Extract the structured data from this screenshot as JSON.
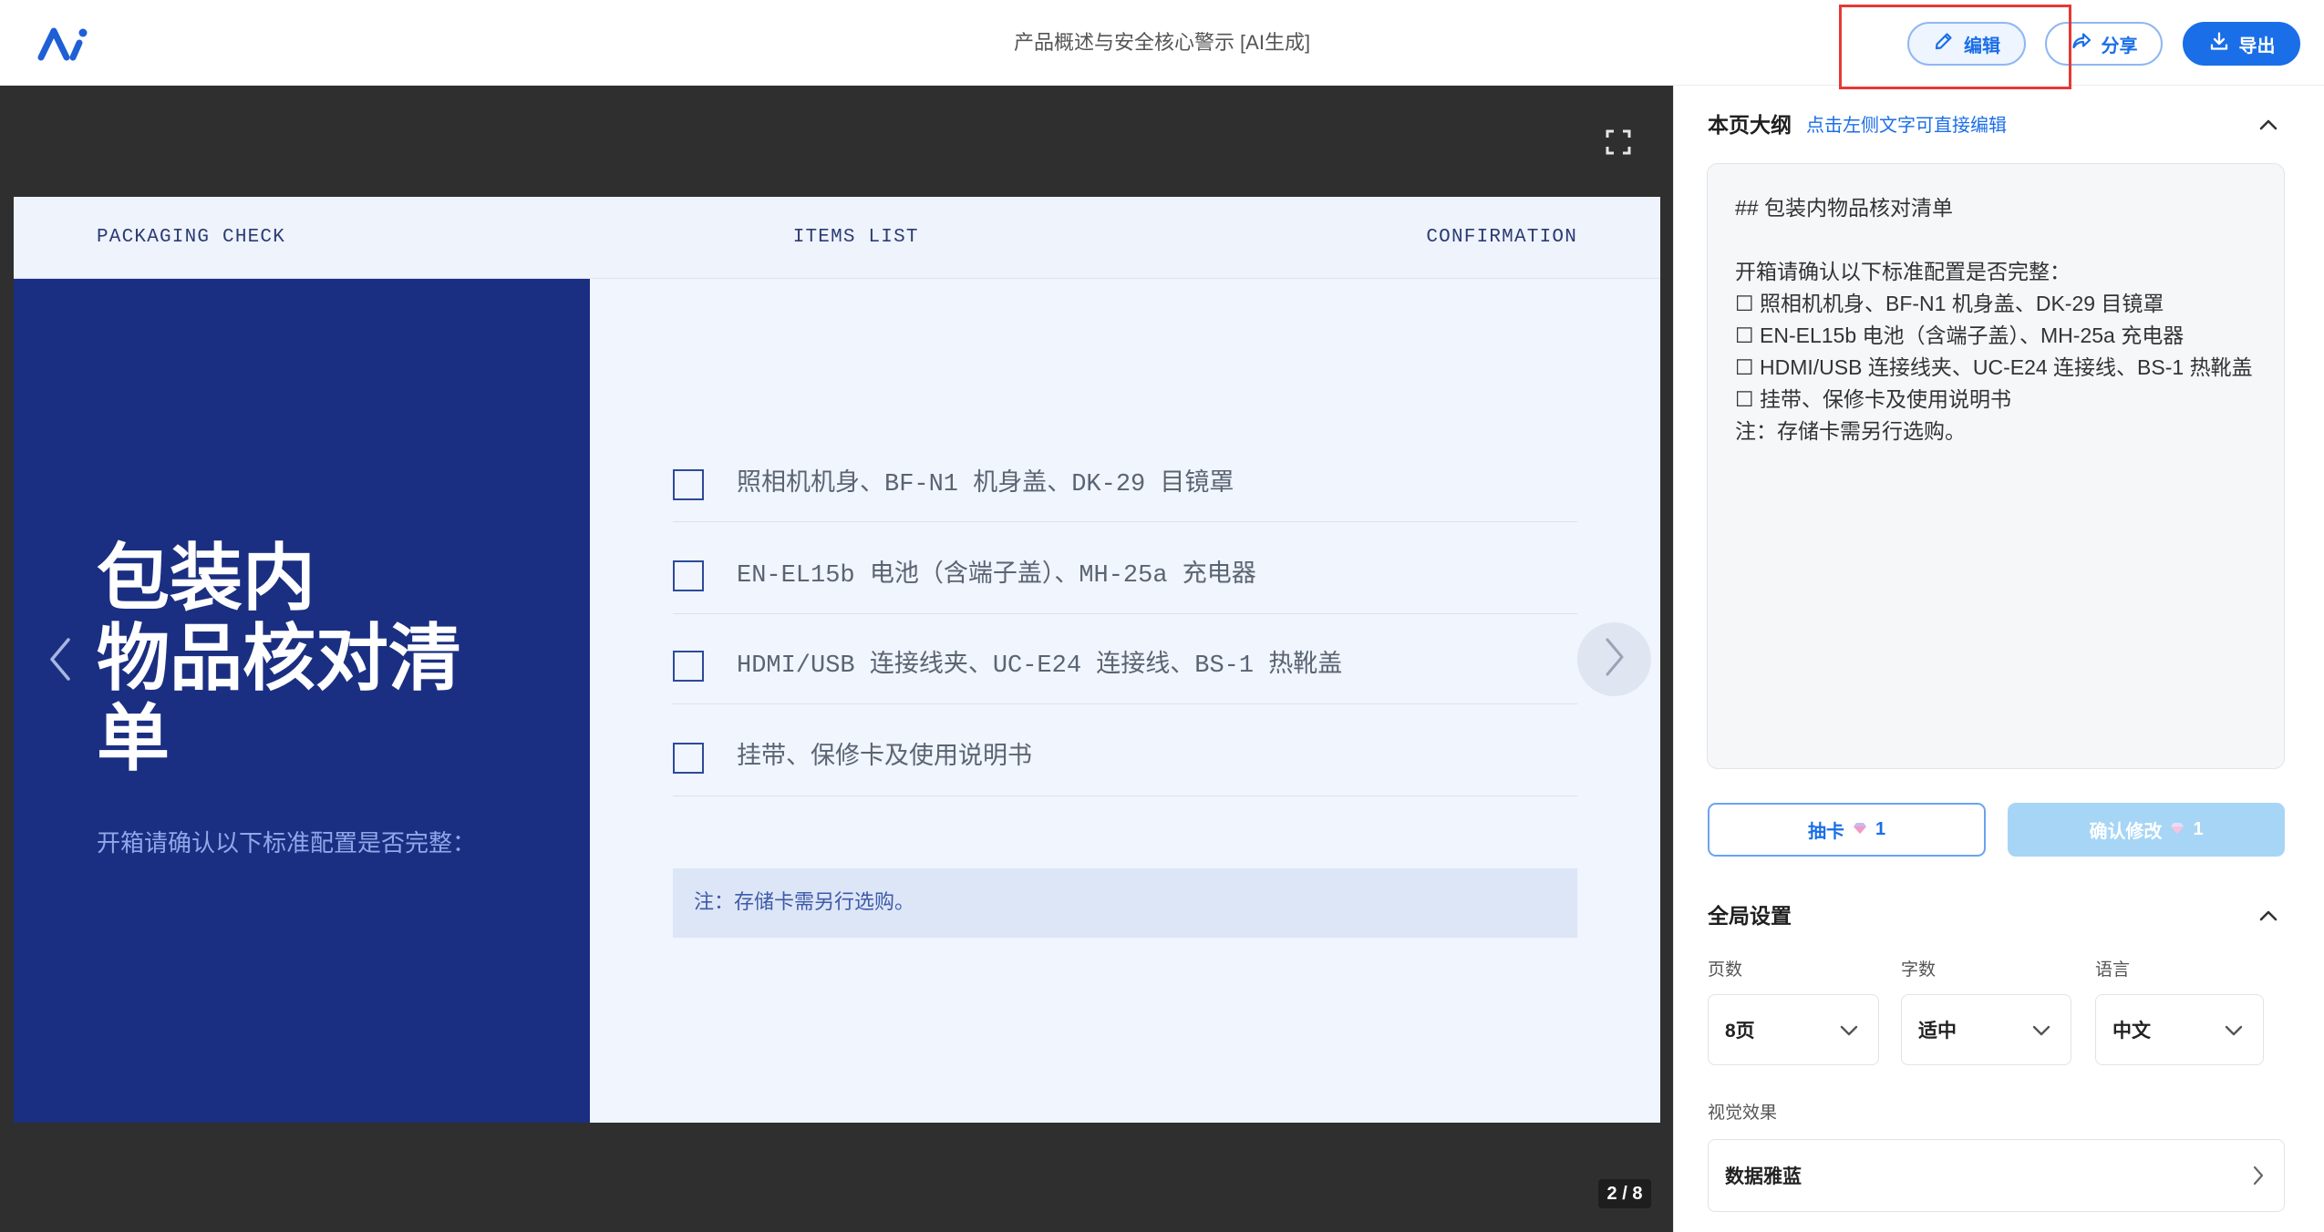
{
  "header": {
    "title": "产品概述与安全核心警示 [AI生成]",
    "logo_icon": "logo-mark",
    "buttons": {
      "edit": {
        "label": "编辑",
        "icon": "pencil-icon"
      },
      "share": {
        "label": "分享",
        "icon": "share-icon"
      },
      "export": {
        "label": "导出",
        "icon": "download-icon"
      }
    }
  },
  "canvas": {
    "fullscreen_icon": "fullscreen-icon",
    "page_indicator": "2 / 8"
  },
  "slide": {
    "top_bar": {
      "left": "PACKAGING CHECK",
      "center": "ITEMS LIST",
      "right": "CONFIRMATION"
    },
    "title_lines": [
      "包装内",
      "物品核对清",
      "单"
    ],
    "subtitle": "开箱请确认以下标准配置是否完整：",
    "checklist": [
      {
        "text": "照相机机身、BF-N1 机身盖、DK-29 目镜罩",
        "checked": false
      },
      {
        "text": "EN-EL15b 电池（含端子盖）、MH-25a 充电器",
        "checked": false
      },
      {
        "text": "HDMI/USB 连接线夹、UC-E24 连接线、BS-1 热靴盖",
        "checked": false
      },
      {
        "text": "挂带、保修卡及使用说明书",
        "checked": false
      }
    ],
    "note": "注：存储卡需另行选购。",
    "nav": {
      "prev_icon": "chevron-left-icon",
      "next_icon": "chevron-right-icon"
    }
  },
  "sidebar": {
    "outline": {
      "heading": "本页大纲",
      "hint": "点击左侧文字可直接编辑",
      "text": "## 包装内物品核对清单\n\n开箱请确认以下标准配置是否完整：\n☐ 照相机机身、BF-N1 机身盖、DK-29 目镜罩\n☐ EN-EL15b 电池（含端子盖）、MH-25a 充电器\n☐ HDMI/USB 连接线夹、UC-E24 连接线、BS-1 热靴盖\n☐ 挂带、保修卡及使用说明书\n注：存储卡需另行选购。",
      "draw_card": {
        "label": "抽卡",
        "cost": "1",
        "icon": "gem-icon"
      },
      "confirm": {
        "label": "确认修改",
        "cost": "1",
        "icon": "gem-icon"
      }
    },
    "global_settings": {
      "heading": "全局设置",
      "fields": [
        {
          "label": "页数",
          "value": "8页"
        },
        {
          "label": "字数",
          "value": "适中"
        },
        {
          "label": "语言",
          "value": "中文"
        }
      ],
      "visual": {
        "label": "视觉效果",
        "value": "数据雅蓝"
      }
    }
  },
  "colors": {
    "accent": "#1a6ee8",
    "slide-panel": "#1b2f82",
    "canvas": "#2f2f2f",
    "slide-bg": "#f0f5fe",
    "confirm-bg": "#a6d5f6",
    "highlight": "#e53935"
  }
}
